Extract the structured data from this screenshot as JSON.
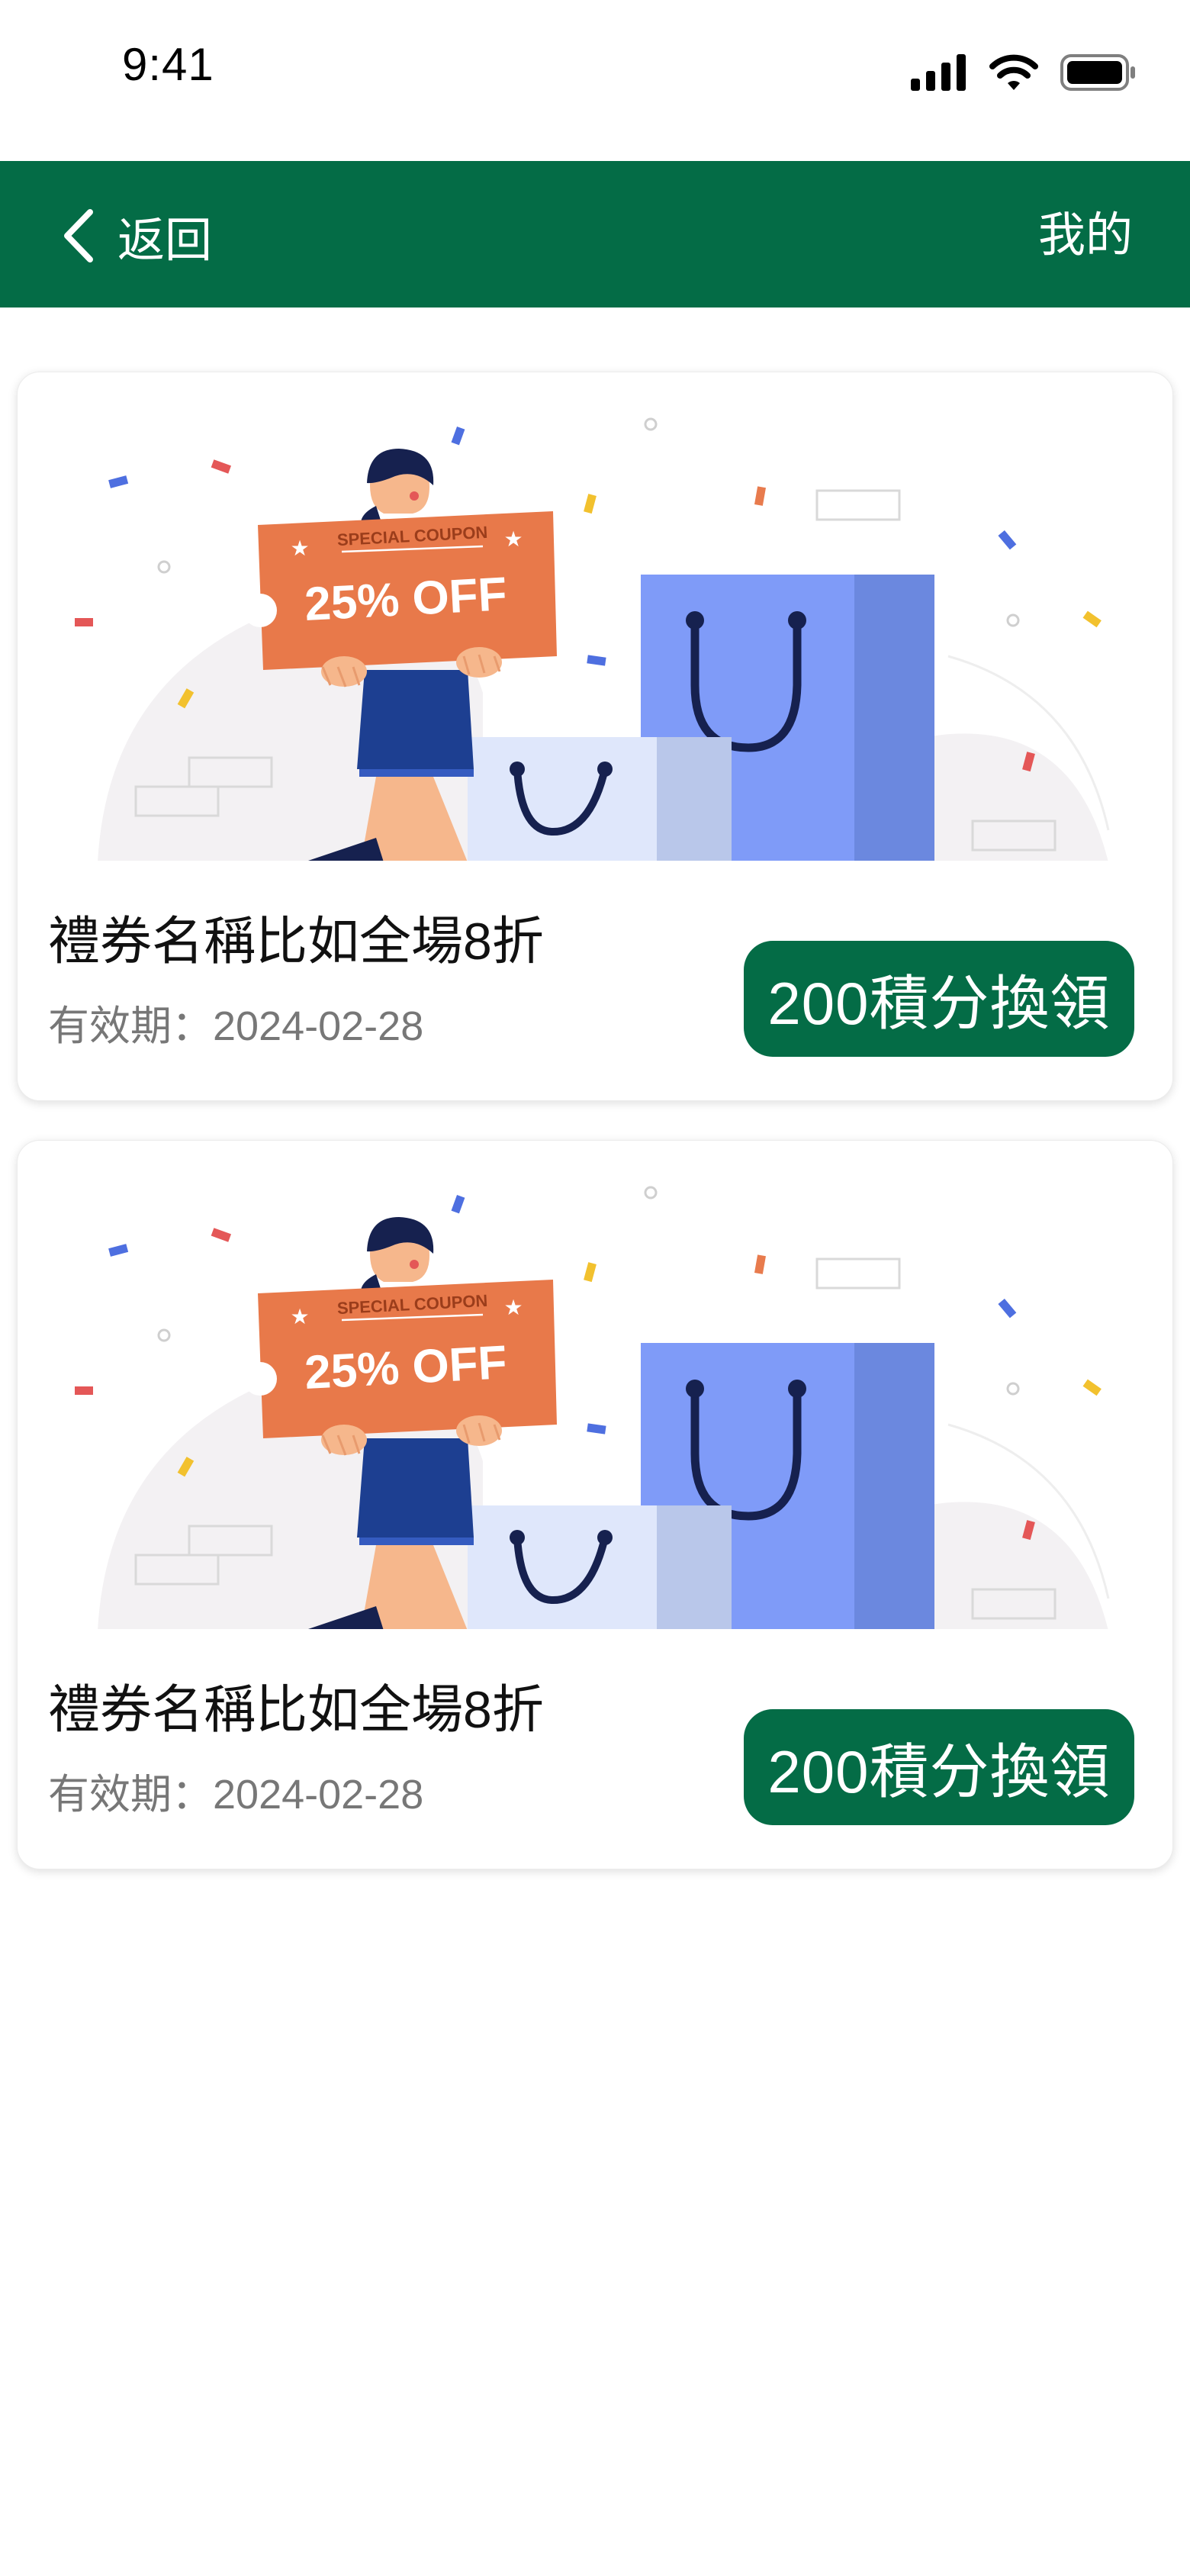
{
  "status_bar": {
    "time": "9:41",
    "icons": [
      "signal-icon",
      "wifi-icon",
      "battery-icon"
    ]
  },
  "nav": {
    "back_label": "返回",
    "right_label": "我的",
    "background": "#046c46"
  },
  "coupons": [
    {
      "illustration": {
        "badge_top": "SPECIAL COUPON",
        "badge_main": "25% OFF"
      },
      "title": "禮券名稱比如全場8折",
      "validity": "有效期：2024-02-28",
      "redeem_label": "200積分換領"
    },
    {
      "illustration": {
        "badge_top": "SPECIAL COUPON",
        "badge_main": "25% OFF"
      },
      "title": "禮券名稱比如全場8折",
      "validity": "有效期：2024-02-28",
      "redeem_label": "200積分換領"
    }
  ]
}
